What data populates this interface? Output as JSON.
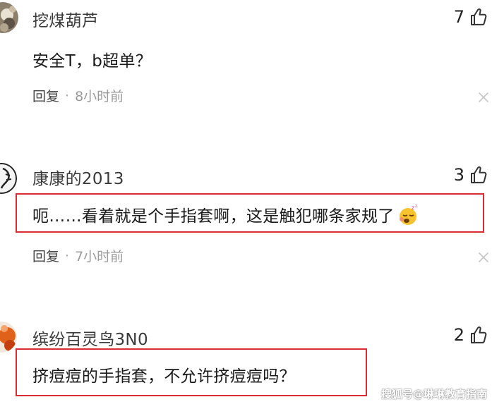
{
  "comments": [
    {
      "username": "挖煤葫芦",
      "likes": "7",
      "text": "安全T，b超单？",
      "reply_label": "回复",
      "separator": "·",
      "time": "8小时前"
    },
    {
      "username": "康康的2013",
      "likes": "3",
      "text": "呃……看着就是个手指套啊，这是触犯哪条家规了",
      "emoji": "sleepy-face-emoji",
      "reply_label": "回复",
      "separator": "·",
      "time": "7小时前"
    },
    {
      "username": "缤纷百灵鸟3N0",
      "likes": "2",
      "text": "挤痘痘的手指套，不允许挤痘痘吗？"
    }
  ],
  "watermark": "搜狐号@琳琳教育指南",
  "colors": {
    "highlight_border": "#d92c35",
    "muted_text": "#9a9a9a"
  },
  "icons": {
    "like": "thumbs-up-icon",
    "close": "close-icon"
  }
}
